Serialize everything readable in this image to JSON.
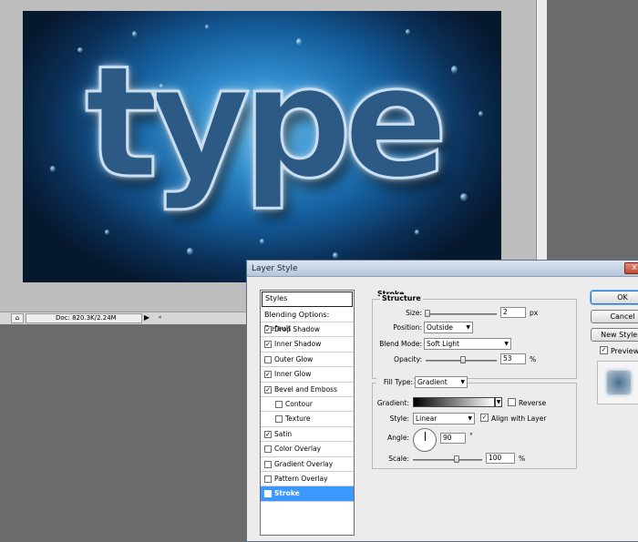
{
  "canvas": {
    "text": "type"
  },
  "statusbar": {
    "doc": "Doc: 820.3K/2.24M",
    "play": "▶",
    "left": "◂",
    "icon": "⌂"
  },
  "dialog": {
    "title": "Layer Style",
    "close": "x",
    "styles_header": "Styles",
    "blending": "Blending Options: Default",
    "styles": [
      {
        "label": "Drop Shadow",
        "checked": true,
        "indent": false
      },
      {
        "label": "Inner Shadow",
        "checked": true,
        "indent": false
      },
      {
        "label": "Outer Glow",
        "checked": false,
        "indent": false
      },
      {
        "label": "Inner Glow",
        "checked": true,
        "indent": false
      },
      {
        "label": "Bevel and Emboss",
        "checked": true,
        "indent": false
      },
      {
        "label": "Contour",
        "checked": false,
        "indent": true
      },
      {
        "label": "Texture",
        "checked": false,
        "indent": true
      },
      {
        "label": "Satin",
        "checked": true,
        "indent": false
      },
      {
        "label": "Color Overlay",
        "checked": false,
        "indent": false
      },
      {
        "label": "Gradient Overlay",
        "checked": false,
        "indent": false
      },
      {
        "label": "Pattern Overlay",
        "checked": false,
        "indent": false
      },
      {
        "label": "Stroke",
        "checked": true,
        "indent": false,
        "selected": true
      }
    ],
    "panel": {
      "title": "Stroke",
      "structure": {
        "legend": "Structure",
        "size_label": "Size:",
        "size_value": "2",
        "size_unit": "px",
        "position_label": "Position:",
        "position_value": "Outside",
        "blend_label": "Blend Mode:",
        "blend_value": "Soft Light",
        "opacity_label": "Opacity:",
        "opacity_value": "53",
        "opacity_unit": "%"
      },
      "fill": {
        "fill_type_label": "Fill Type:",
        "fill_type_value": "Gradient",
        "gradient_label": "Gradient:",
        "reverse_label": "Reverse",
        "reverse_checked": false,
        "style_label": "Style:",
        "style_value": "Linear",
        "align_label": "Align with Layer",
        "align_checked": true,
        "angle_label": "Angle:",
        "angle_value": "90",
        "angle_unit": "°",
        "scale_label": "Scale:",
        "scale_value": "100",
        "scale_unit": "%"
      }
    },
    "buttons": {
      "ok": "OK",
      "cancel": "Cancel",
      "new_style": "New Style..."
    },
    "preview_label": "Preview",
    "preview_checked": true
  }
}
